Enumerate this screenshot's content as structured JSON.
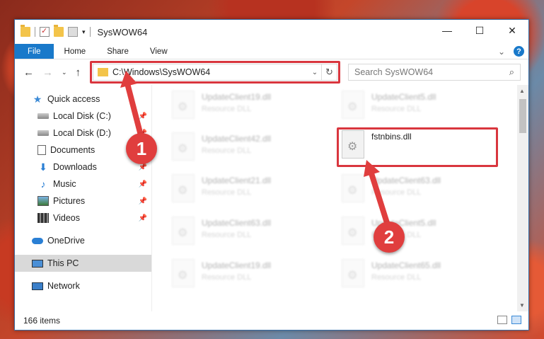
{
  "window": {
    "title": "SysWOW64",
    "controls": {
      "minimize": "—",
      "maximize": "☐",
      "close": "✕"
    }
  },
  "ribbon": {
    "tabs": [
      "File",
      "Home",
      "Share",
      "View"
    ],
    "help": "?",
    "collapse": "⌄"
  },
  "nav_buttons": {
    "back": "←",
    "forward": "→",
    "recent": "⌄",
    "up": "↑"
  },
  "address": {
    "path": "C:\\Windows\\SysWOW64",
    "dropdown": "⌄",
    "refresh": "↻"
  },
  "search": {
    "placeholder": "Search SysWOW64",
    "icon": "⌕"
  },
  "sidebar": {
    "items": [
      {
        "label": "Quick access",
        "icon": "star-icon",
        "pinned": false
      },
      {
        "label": "Local Disk (C:)",
        "icon": "drive-icon",
        "pinned": true
      },
      {
        "label": "Local Disk (D:)",
        "icon": "drive-icon",
        "pinned": true
      },
      {
        "label": "Documents",
        "icon": "documents-icon",
        "pinned": true
      },
      {
        "label": "Downloads",
        "icon": "downloads-icon",
        "pinned": true
      },
      {
        "label": "Music",
        "icon": "music-icon",
        "pinned": true
      },
      {
        "label": "Pictures",
        "icon": "pictures-icon",
        "pinned": true
      },
      {
        "label": "Videos",
        "icon": "videos-icon",
        "pinned": true
      },
      {
        "label": "OneDrive",
        "icon": "onedrive-icon",
        "pinned": false
      },
      {
        "label": "This PC",
        "icon": "this-pc-icon",
        "pinned": false,
        "selected": true
      },
      {
        "label": "Network",
        "icon": "network-icon",
        "pinned": false
      }
    ],
    "pin_glyph": "📌"
  },
  "files": [
    {
      "name": "UpdateClient19.dll",
      "type": "Resource DLL"
    },
    {
      "name": "UpdateClient5.dll",
      "type": "Resource DLL"
    },
    {
      "name": "UpdateClient42.dll",
      "type": "Resource DLL"
    },
    {
      "name": "fstnbins.dll",
      "type": "",
      "highlighted": true
    },
    {
      "name": "UpdateClient21.dll",
      "type": "Resource DLL"
    },
    {
      "name": "UpdateClient63.dll",
      "type": "Resource DLL"
    },
    {
      "name": "UpdateClient63.dll",
      "type": "Resource DLL"
    },
    {
      "name": "UpdateClient5.dll",
      "type": "Resource DLL"
    },
    {
      "name": "UpdateClient19.dll",
      "type": "Resource DLL"
    },
    {
      "name": "UpdateClient65.dll",
      "type": "Resource DLL"
    }
  ],
  "status": {
    "count": "166 items"
  },
  "annotations": {
    "step1": "1",
    "step2": "2",
    "color": "#e03e3e"
  }
}
